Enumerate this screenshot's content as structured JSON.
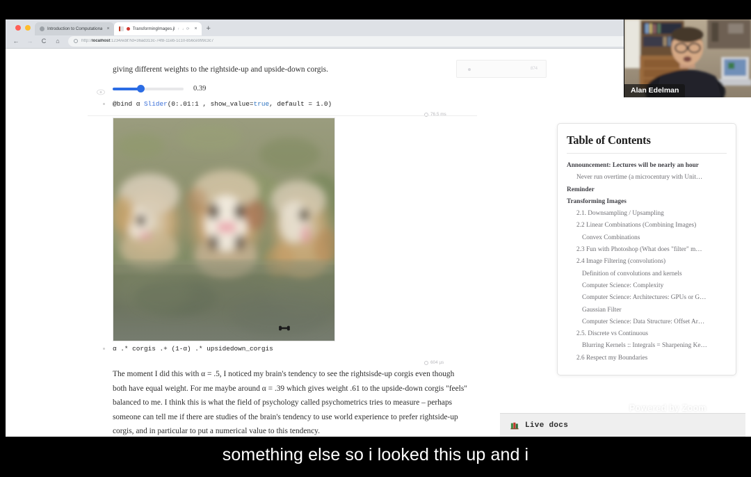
{
  "browser": {
    "traffic_lights": [
      "close",
      "minimize",
      "zoom"
    ],
    "tabs": [
      {
        "title": "Introduction to Computationa",
        "favicon": "globe-icon",
        "active": false,
        "has_unsaved_dot": false,
        "suffix": ""
      },
      {
        "title": "TransformingImages.jl",
        "favicon": "pluto-icon",
        "active": true,
        "has_unsaved_dot": true,
        "suffix": "↑ ↓ ⟳"
      }
    ],
    "new_tab_label": "+",
    "nav": {
      "back": "←",
      "forward": "→",
      "reload": "C",
      "home": "⌂"
    },
    "omnibox": {
      "scheme": "http://",
      "host": "localhost",
      "path": "1234/edit?id=36ad313c-74f8-11eb-1c10-856ce999c3c7",
      "full_url": "http://localhost:1234/edit?id=36ad313c-74f8-11eb-1c10-856ce999c3c7"
    }
  },
  "notebook": {
    "intro_text": "giving different weights to the rightside-up and upside-down corgis.",
    "slider": {
      "value_label": "0.39",
      "value": 0.39,
      "min": 0,
      "max": 1,
      "step": 0.01,
      "fill_color": "#2b6ce4"
    },
    "slider_code": {
      "prefix": "@bind α ",
      "fn": "Slider",
      "args_a": "(0:.01:1 , show_value=",
      "kw_true": "true",
      "args_b": ", default = ",
      "default": "1.0",
      "close": ")",
      "full": "@bind α Slider(0:.01:1 , show_value=true, default = 1.0)"
    },
    "slider_cell_timing": "76.5 ms",
    "output_image": {
      "alt": "blended corgi image — rightside-up corgis linearly combined with upside-down corgis on grass",
      "watermark": "bone-icon"
    },
    "combination_code": {
      "full": "α .* corgis .+ (1-α) .* upsidedown_corgis",
      "tok_alpha": "α",
      "tok_op1": " .* ",
      "tok_corgis": "corgis",
      "tok_op2": " .+ ",
      "tok_paren": "(1-α)",
      "tok_op3": " .* ",
      "tok_upside": "upsidedown_corgis"
    },
    "combination_cell_timing": "604 µs",
    "paragraph": "The moment I did this with α = .5, I noticed my brain's tendency to see the rightsisde-up corgis even though both have equal weight. For me maybe around α = .39 which gives weight .61 to the upside-down corgis \"feels\" balanced to me. I think this is what the field of psychology called psychometrics tries to measure – perhaps someone can tell me if there are studies of the brain's tendency to use world experience to prefer rightside-up corgis, and in particular to put a numerical value to this tendency.",
    "top_right_fragment": {
      "value": "874"
    },
    "gutter_eye_icon": "eye-icon"
  },
  "table_of_contents": {
    "title": "Table of Contents",
    "items": [
      {
        "label": "Announcement: Lectures will be nearly an hour",
        "level": 1
      },
      {
        "label": "Never run overtime (a microcentury with Unit…",
        "level": 2
      },
      {
        "label": "Reminder",
        "level": 1
      },
      {
        "label": "Transforming Images",
        "level": 1
      },
      {
        "label": "2.1. Downsampling / Upsampling",
        "level": 2
      },
      {
        "label": "2.2 Linear Combinations (Combining Images)",
        "level": 2
      },
      {
        "label": "Convex Combinations",
        "level": 3
      },
      {
        "label": "2.3 Fun with Photoshop (What does \"filter\" m…",
        "level": 2
      },
      {
        "label": "2.4 Image Filtering (convolutions)",
        "level": 2
      },
      {
        "label": "Definition of convolutions and kernels",
        "level": 3
      },
      {
        "label": "Computer Science: Complexity",
        "level": 3
      },
      {
        "label": "Computer Science: Architectures: GPUs or G…",
        "level": 3
      },
      {
        "label": "Gaussian Filter",
        "level": 3
      },
      {
        "label": "Computer Science: Data Structure: Offset Ar…",
        "level": 3
      },
      {
        "label": "2.5. Discrete vs Continuous",
        "level": 2
      },
      {
        "label": "Blurring Kernels :: Integrals = Sharpening Ke…",
        "level": 3
      },
      {
        "label": "2.6 Respect my Boundaries",
        "level": 2
      }
    ]
  },
  "webcam": {
    "participant_name": "Alan Edelman",
    "alt": "presenter at desk in home office with bookshelf and laptop"
  },
  "overlays": {
    "mit_logo": "mit-logo",
    "powered_by": "Powered by Zoom",
    "live_docs_label": "Live docs",
    "live_docs_icon": "books-icon"
  },
  "caption": {
    "text": "something else so i looked this up and i"
  },
  "colors": {
    "slider_blue": "#2b6ce4",
    "browser_chrome": "#dee1e6",
    "page_background": "#ffffff",
    "caption_text": "#ffffff",
    "letterbox": "#000000",
    "toc_border": "#e2e2e2"
  }
}
